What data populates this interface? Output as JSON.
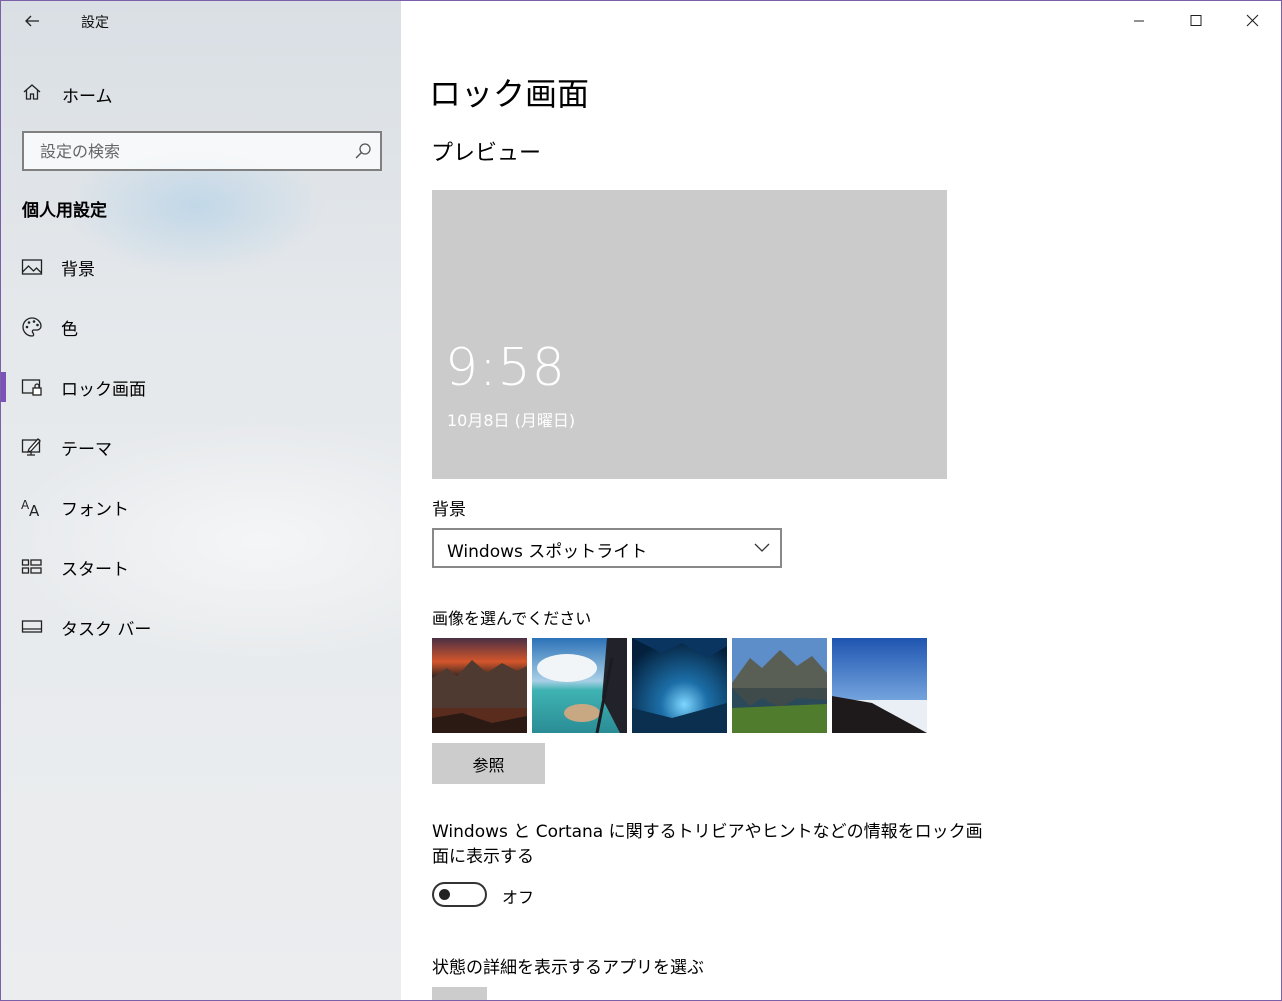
{
  "window": {
    "title": "設定",
    "accent_color": "#7a52b8"
  },
  "sidebar": {
    "home_label": "ホーム",
    "search_placeholder": "設定の検索",
    "section_title": "個人用設定",
    "items": [
      {
        "label": "背景",
        "icon": "picture-icon"
      },
      {
        "label": "色",
        "icon": "palette-icon"
      },
      {
        "label": "ロック画面",
        "icon": "lock-screen-icon",
        "active": true
      },
      {
        "label": "テーマ",
        "icon": "theme-icon"
      },
      {
        "label": "フォント",
        "icon": "font-icon"
      },
      {
        "label": "スタート",
        "icon": "start-icon"
      },
      {
        "label": "タスク バー",
        "icon": "taskbar-icon"
      }
    ]
  },
  "main": {
    "page_title": "ロック画面",
    "preview_title": "プレビュー",
    "preview": {
      "time": "9:58",
      "date": "10月8日 (月曜日)",
      "background_color": "#cbcbcb"
    },
    "background_label": "背景",
    "background_value": "Windows スポットライト",
    "choose_picture_label": "画像を選んでください",
    "browse_label": "参照",
    "cortana_text": "Windows と Cortana に関するトリビアやヒントなどの情報をロック画面に表示する",
    "toggle_state": "オフ",
    "status_apps_label": "状態の詳細を表示するアプリを選ぶ"
  }
}
